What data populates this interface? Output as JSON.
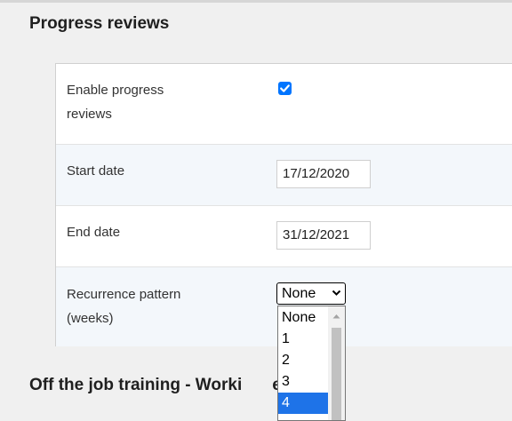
{
  "section": {
    "title": "Progress reviews"
  },
  "form": {
    "enable_label_line1": "Enable progress",
    "enable_label_line2": "reviews",
    "enable_checked": true,
    "start_label": "Start date",
    "start_value": "17/12/2020",
    "end_label": "End date",
    "end_value": "31/12/2021",
    "recurrence_label_line1": "Recurrence pattern",
    "recurrence_label_line2": "(weeks)",
    "recurrence_selected": "None"
  },
  "dropdown": {
    "options": [
      "None",
      "1",
      "2",
      "3",
      "4"
    ],
    "highlighted": "4"
  },
  "next_section": {
    "title_visible_left": "Off the job training - Worki",
    "title_visible_right": "e"
  },
  "colors": {
    "accent": "#0075ff",
    "highlight": "#1e73e8",
    "alt_row": "#f3f7fb"
  }
}
